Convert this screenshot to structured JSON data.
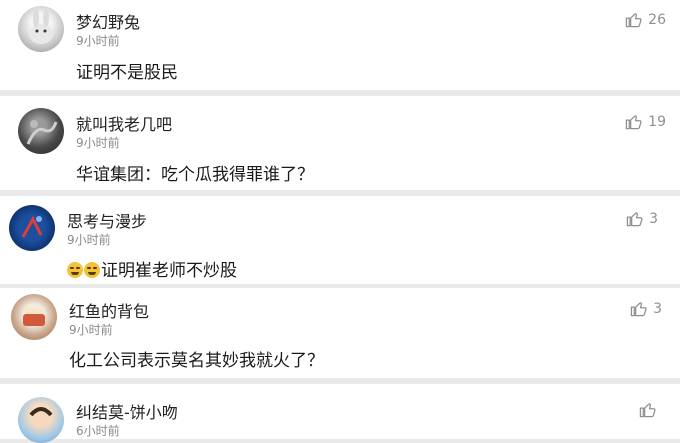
{
  "comments": [
    {
      "name": "梦幻野兔",
      "time": "9小时前",
      "text": "证明不是股民",
      "likes": "26",
      "avatar": "rabbit-avatar"
    },
    {
      "name": "就叫我老几吧",
      "time": "9小时前",
      "text": "华谊集团：吃个瓜我得罪谁了？",
      "likes": "19",
      "avatar": "dark-avatar"
    },
    {
      "name": "思考与漫步",
      "time": "9小时前",
      "text": "证明崔老师不炒股",
      "likes": "3",
      "emojis": [
        "laugh-cry-emoji",
        "laugh-cry-emoji"
      ],
      "avatar": "blue-avatar"
    },
    {
      "name": "红鱼的背包",
      "time": "9小时前",
      "text": "化工公司表示莫名其妙我就火了？",
      "likes": "3",
      "avatar": "food-avatar"
    },
    {
      "name": "纠结莫-饼小吻",
      "time": "6小时前",
      "text": "",
      "likes": "",
      "avatar": "kid-avatar"
    }
  ],
  "colors": {
    "background": "#e9e9e9",
    "card": "#ffffff",
    "meta": "#8a8a8a",
    "like": "#8f8f8f"
  }
}
